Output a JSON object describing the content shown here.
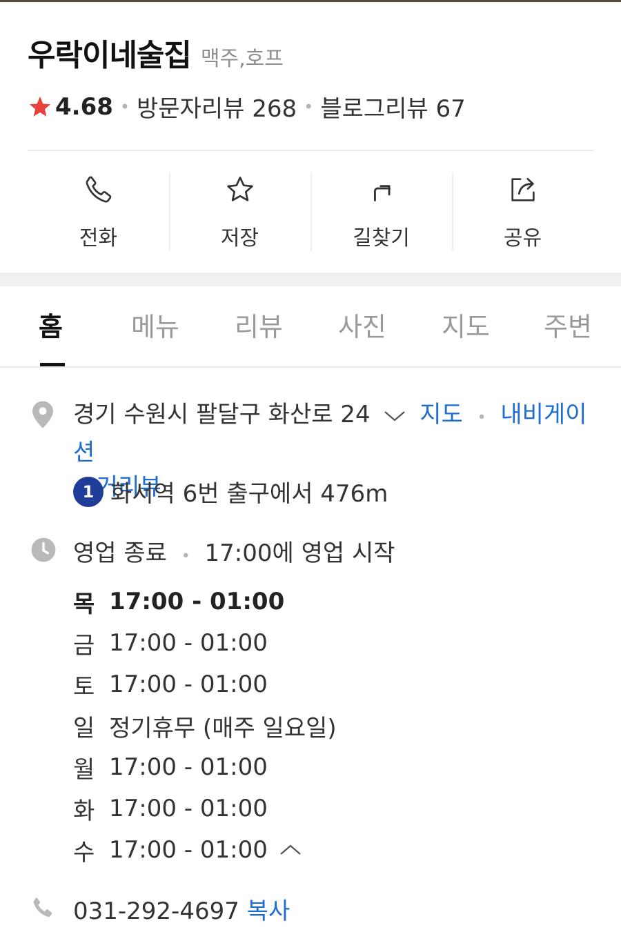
{
  "place": {
    "name": "우락이네술집",
    "category": "맥주,호프",
    "rating": "4.68",
    "visitor_reviews": "방문자리뷰 268",
    "blog_reviews": "블로그리뷰 67"
  },
  "actions": [
    {
      "label": "전화",
      "icon": "phone-icon"
    },
    {
      "label": "저장",
      "icon": "star-outline-icon"
    },
    {
      "label": "길찾기",
      "icon": "directions-icon"
    },
    {
      "label": "공유",
      "icon": "share-icon"
    }
  ],
  "tabs": [
    {
      "label": "홈",
      "active": true
    },
    {
      "label": "메뉴"
    },
    {
      "label": "리뷰"
    },
    {
      "label": "사진"
    },
    {
      "label": "지도"
    },
    {
      "label": "주변"
    }
  ],
  "address": {
    "text": "경기 수원시 팔달구 화산로 24",
    "links": [
      "지도",
      "내비게이션",
      "거리뷰"
    ]
  },
  "subway": {
    "line": "1",
    "text": "화서역 6번 출구에서 476m"
  },
  "hours": {
    "status": "영업 종료",
    "next": "17:00에 영업 시작",
    "days": [
      {
        "day": "목",
        "time": "17:00 - 01:00"
      },
      {
        "day": "금",
        "time": "17:00 - 01:00"
      },
      {
        "day": "토",
        "time": "17:00 - 01:00"
      },
      {
        "day": "일",
        "time": "정기휴무 (매주 일요일)"
      },
      {
        "day": "월",
        "time": "17:00 - 01:00"
      },
      {
        "day": "화",
        "time": "17:00 - 01:00"
      },
      {
        "day": "수",
        "time": "17:00 - 01:00"
      }
    ]
  },
  "contact": {
    "phone": "031-292-4697",
    "copy_label": "복사"
  },
  "colors": {
    "link": "#1f6cd3",
    "star": "#e9413b",
    "subway_line_1": "#1f3d98"
  }
}
